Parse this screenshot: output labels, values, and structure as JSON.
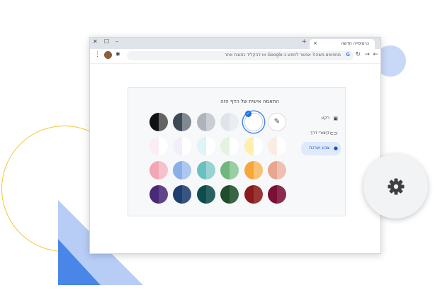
{
  "tab": {
    "title": "כרטיסייה חדשה",
    "close": "×",
    "new_tab": "+"
  },
  "window_controls": {
    "close": "✕",
    "maximize": "☐",
    "minimize": "–"
  },
  "omnibox": {
    "text": "מחפשים משהו? אפשר לחפש ב-Google או להקליד כתובת אתר",
    "logo": "G"
  },
  "panel": {
    "title": "התאמה אישית של הדף הזה",
    "sidebar": [
      {
        "label": "רקע",
        "icon": "image-icon"
      },
      {
        "label": "קיצורי דרך",
        "icon": "link-icon"
      },
      {
        "label": "צבע וערכת",
        "icon": "palette-icon"
      }
    ]
  },
  "colors": {
    "accent": "#4a86e8",
    "swatches": [
      [
        "#ffffff",
        "#ffffff",
        "#dfe3ea",
        "#aeb3bd",
        "#3c4a55",
        "#111111"
      ],
      [
        "#f6d9c7",
        "#ffde59",
        "#c8e6c1",
        "#bde9ef",
        "#e5dcf7",
        "#f6dbe6"
      ],
      [
        "#e8a58f",
        "#f7a63a",
        "#6fb77a",
        "#6ac0bf",
        "#8ab0ea",
        "#f3a6b3"
      ],
      [
        "#7a1035",
        "#8b1a1a",
        "#1f4f2a",
        "#0d4d4d",
        "#1d3e6e",
        "#4a2a78"
      ]
    ]
  }
}
